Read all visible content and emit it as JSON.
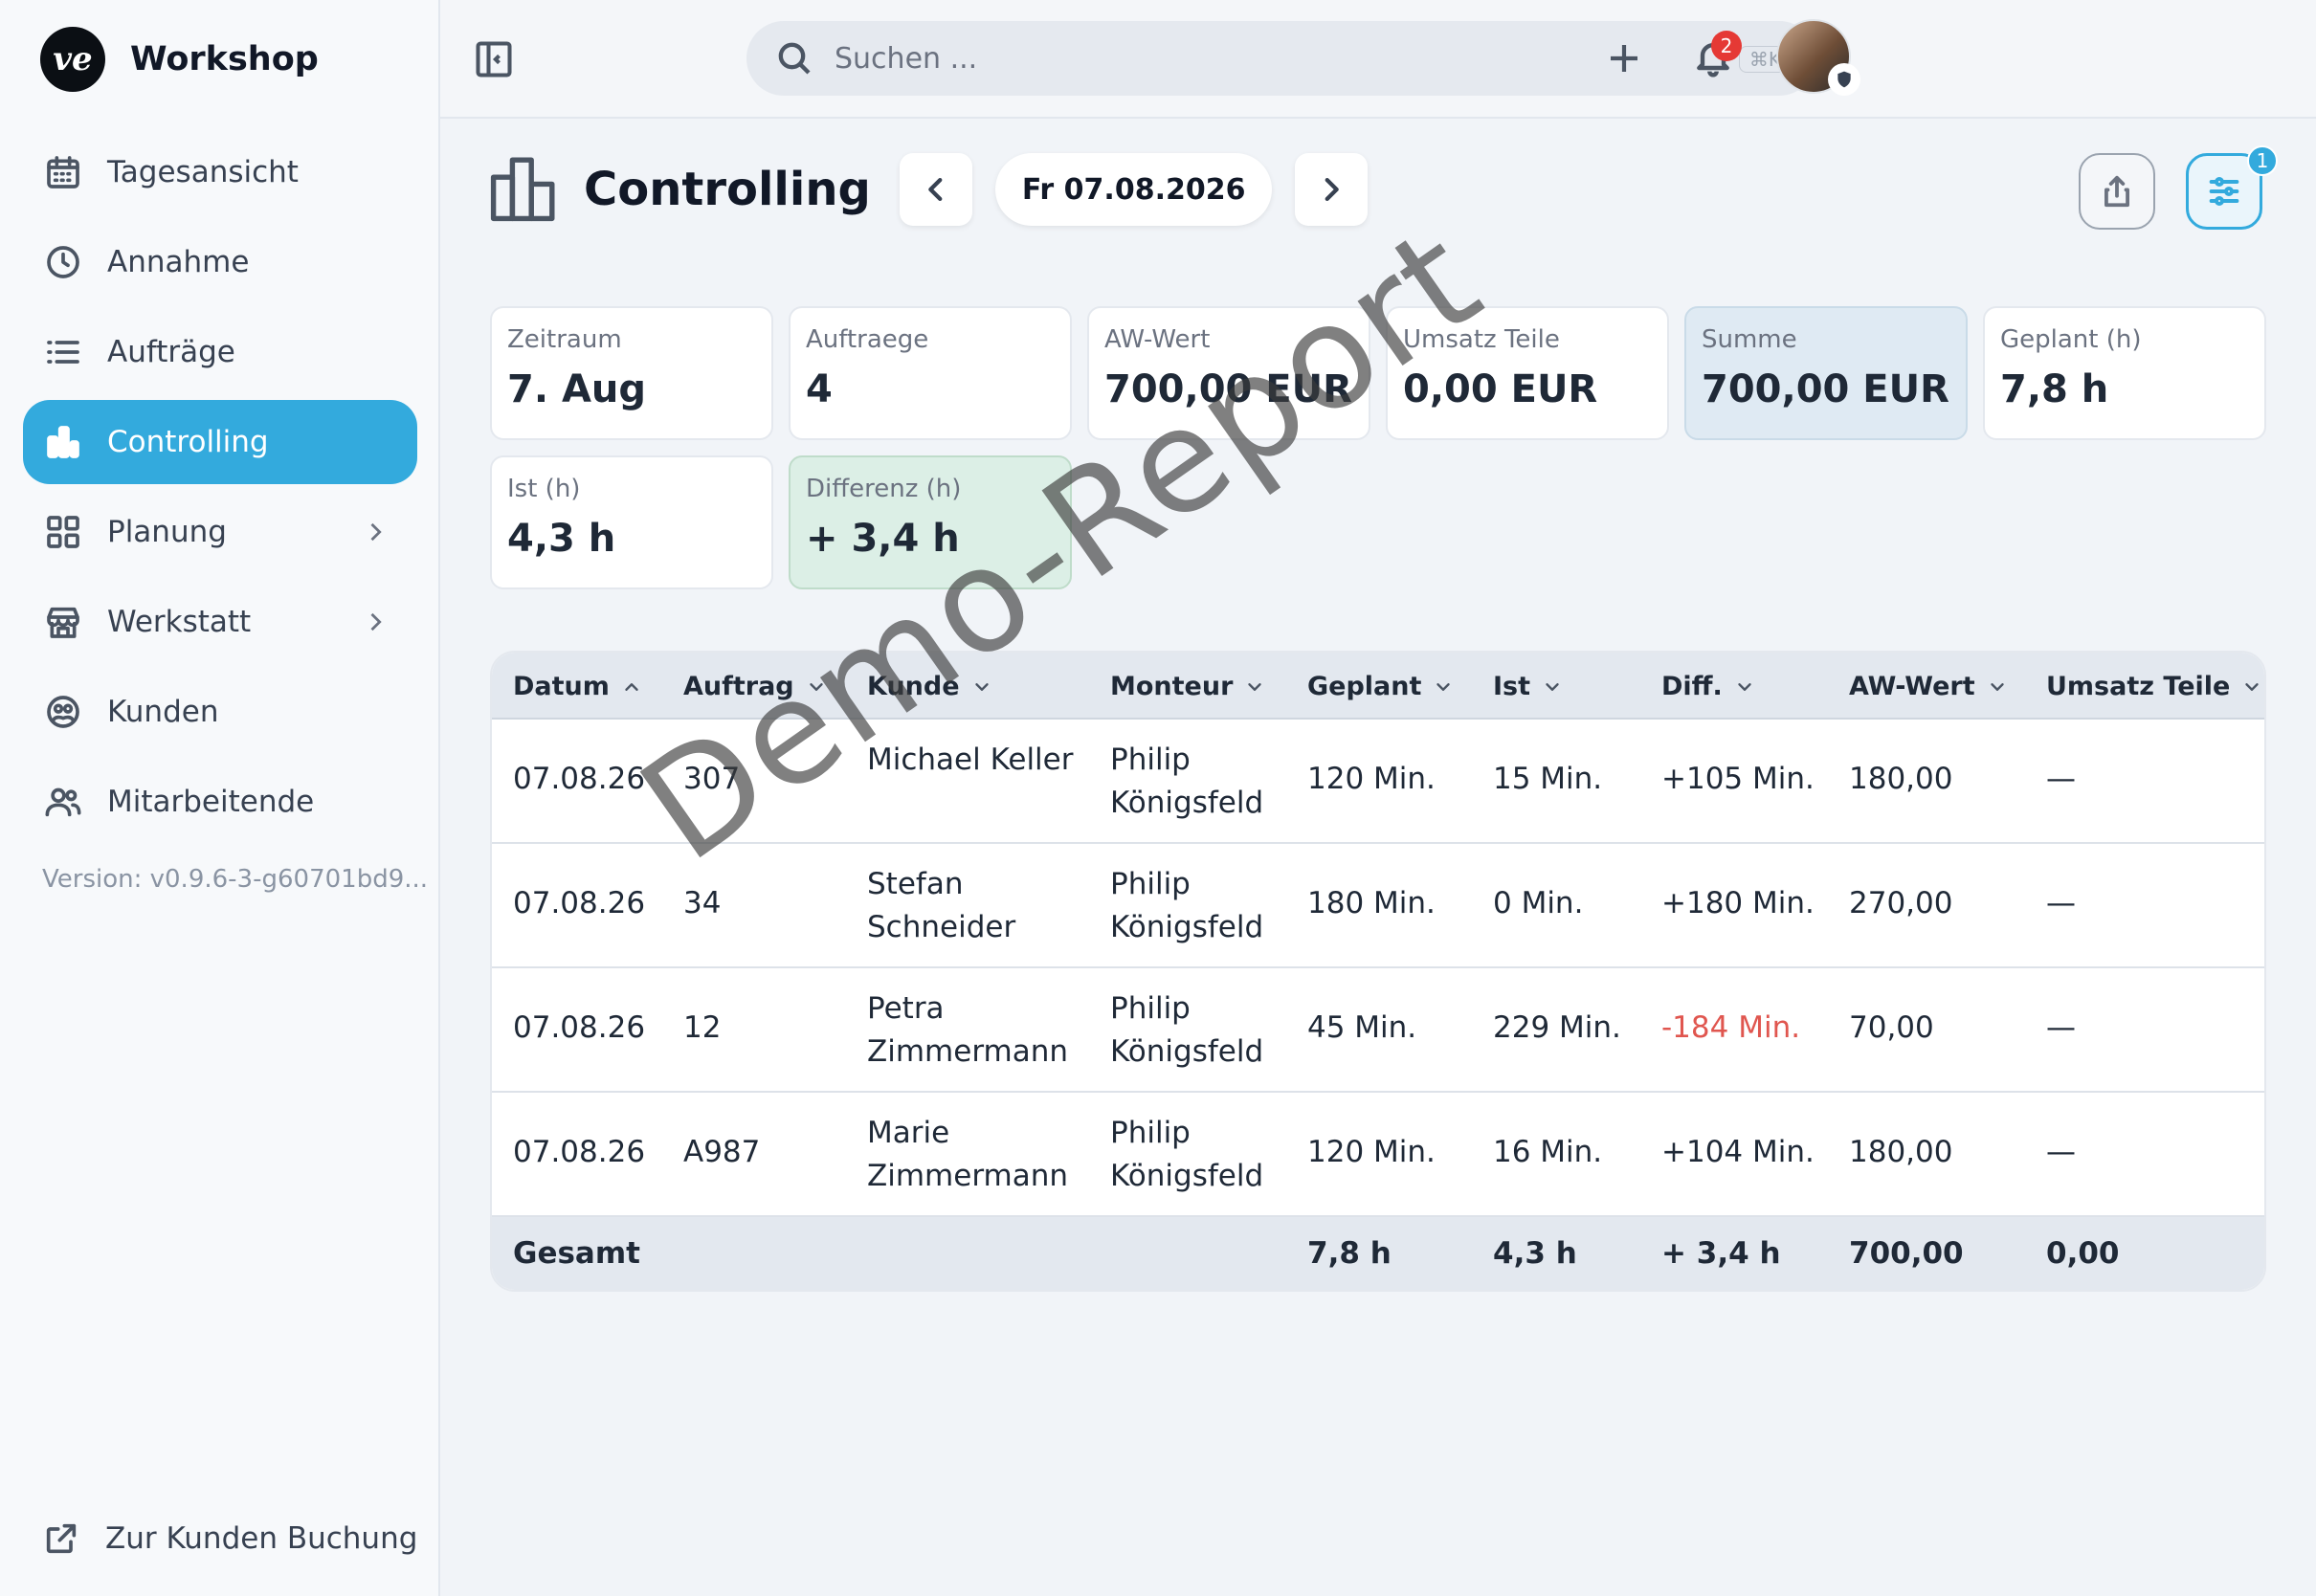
{
  "brand": {
    "logo_text": "ve",
    "name": "Workshop"
  },
  "sidebar": {
    "items": [
      {
        "label": "Tagesansicht",
        "icon": "calendar-icon"
      },
      {
        "label": "Annahme",
        "icon": "clock-icon"
      },
      {
        "label": "Aufträge",
        "icon": "list-icon"
      },
      {
        "label": "Controlling",
        "icon": "bar-chart-icon",
        "active": true
      },
      {
        "label": "Planung",
        "icon": "grid-icon",
        "has_submenu": true
      },
      {
        "label": "Werkstatt",
        "icon": "store-icon",
        "has_submenu": true
      },
      {
        "label": "Kunden",
        "icon": "customers-icon"
      },
      {
        "label": "Mitarbeitende",
        "icon": "users-icon"
      }
    ],
    "version": "Version: v0.9.6-3-g60701bd9...",
    "bottom_link": "Zur Kunden Buchung"
  },
  "topbar": {
    "search_placeholder": "Suchen ...",
    "search_shortcut": "⌘K",
    "notifications_count": "2"
  },
  "page": {
    "title": "Controlling",
    "date": "Fr 07.08.2026",
    "filter_count": "1"
  },
  "summary": [
    {
      "label": "Zeitraum",
      "value": "7. Aug"
    },
    {
      "label": "Auftraege",
      "value": "4"
    },
    {
      "label": "AW-Wert",
      "value": "700,00 EUR"
    },
    {
      "label": "Umsatz Teile",
      "value": "0,00 EUR"
    },
    {
      "label": "Summe",
      "value": "700,00 EUR"
    },
    {
      "label": "Geplant (h)",
      "value": "7,8 h"
    },
    {
      "label": "Ist (h)",
      "value": "4,3 h"
    },
    {
      "label": "Differenz (h)",
      "value": "+ 3,4 h"
    }
  ],
  "table": {
    "columns": [
      "Datum",
      "Auftrag",
      "Kunde",
      "Monteur",
      "Geplant",
      "Ist",
      "Diff.",
      "AW-Wert",
      "Umsatz Teile"
    ],
    "rows": [
      {
        "datum": "07.08.26",
        "auftrag": "307",
        "kunde": "Michael Keller",
        "monteur": "Philip Königsfeld",
        "geplant": "120 Min.",
        "ist": "15 Min.",
        "diff": "+105 Min.",
        "aw": "180,00",
        "umsatz": "—"
      },
      {
        "datum": "07.08.26",
        "auftrag": "34",
        "kunde": "Stefan Schneider",
        "monteur": "Philip Königsfeld",
        "geplant": "180 Min.",
        "ist": "0 Min.",
        "diff": "+180 Min.",
        "aw": "270,00",
        "umsatz": "—"
      },
      {
        "datum": "07.08.26",
        "auftrag": "12",
        "kunde": "Petra Zimmermann",
        "monteur": "Philip Königsfeld",
        "geplant": "45 Min.",
        "ist": "229 Min.",
        "diff": "-184 Min.",
        "aw": "70,00",
        "umsatz": "—"
      },
      {
        "datum": "07.08.26",
        "auftrag": "A987",
        "kunde": "Marie Zimmermann",
        "monteur": "Philip Königsfeld",
        "geplant": "120 Min.",
        "ist": "16 Min.",
        "diff": "+104 Min.",
        "aw": "180,00",
        "umsatz": "—"
      }
    ],
    "footer": {
      "label": "Gesamt",
      "geplant": "7,8 h",
      "ist": "4,3 h",
      "diff": "+ 3,4 h",
      "aw": "700,00",
      "umsatz": "0,00"
    }
  },
  "watermark": "Demo-Report",
  "colors": {
    "accent": "#33aadd",
    "negative": "#e0564f",
    "success_bg": "#dcefe6"
  }
}
